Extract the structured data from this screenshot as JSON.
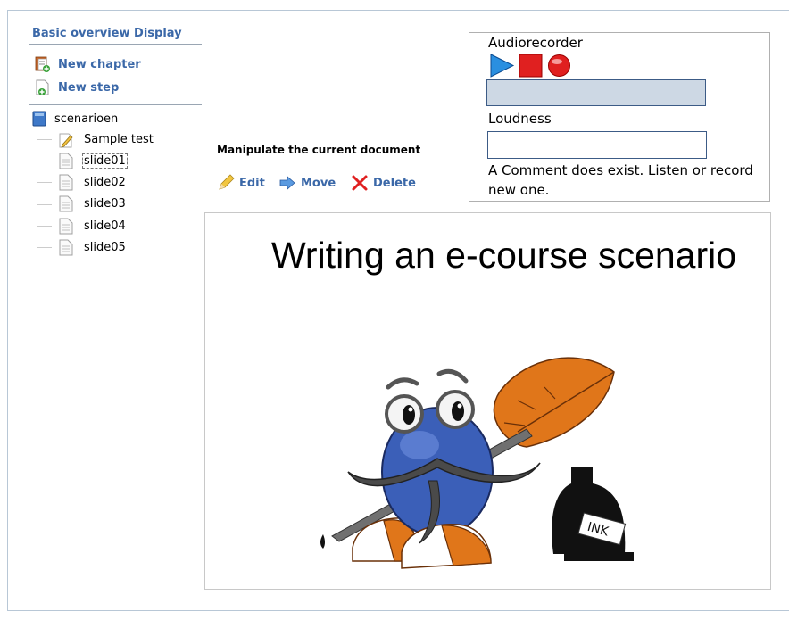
{
  "sidebar": {
    "title": "Basic overview Display",
    "actions": [
      {
        "label": "New chapter",
        "icon": "new-chapter-icon"
      },
      {
        "label": "New step",
        "icon": "new-step-icon"
      }
    ],
    "tree": {
      "root": {
        "label": "scenarioen",
        "icon": "book-icon"
      },
      "items": [
        {
          "label": "Sample test",
          "icon": "test-pencil-icon"
        },
        {
          "label": "slide01",
          "icon": "document-icon",
          "selected": true
        },
        {
          "label": "slide02",
          "icon": "document-icon"
        },
        {
          "label": "slide03",
          "icon": "document-icon"
        },
        {
          "label": "slide04",
          "icon": "document-icon"
        },
        {
          "label": "slide05",
          "icon": "document-icon"
        }
      ]
    }
  },
  "manipulate": {
    "title": "Manipulate the current document",
    "buttons": [
      {
        "label": "Edit",
        "icon": "pencil-icon"
      },
      {
        "label": "Move",
        "icon": "arrow-right-icon"
      },
      {
        "label": "Delete",
        "icon": "red-x-icon"
      }
    ]
  },
  "audio": {
    "title": "Audiorecorder",
    "controls": [
      "play-icon",
      "stop-icon",
      "record-icon"
    ],
    "loudness_label": "Loudness",
    "loudness_value": "",
    "comment": "A Comment does exist. Listen or record new one."
  },
  "slide": {
    "title": "Writing an e-course scenario",
    "ink_label": "INK"
  },
  "colors": {
    "link": "#3b68a8",
    "record_red": "#e02020",
    "play_blue": "#2a8fe0",
    "feather_orange": "#e0761a"
  }
}
